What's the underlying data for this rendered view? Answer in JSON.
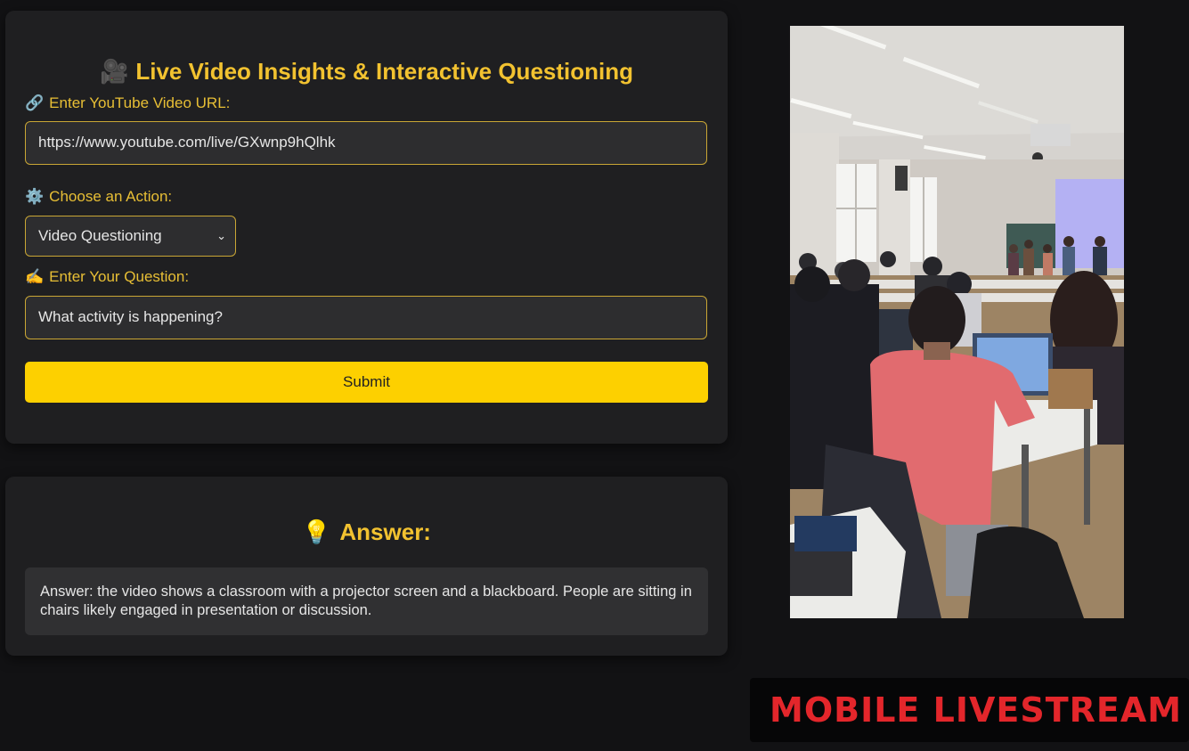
{
  "form": {
    "title_emoji": "🎥",
    "title": "Live Video Insights & Interactive Questioning",
    "url_label_emoji": "🔗",
    "url_label": "Enter YouTube Video URL:",
    "url_value": "https://www.youtube.com/live/GXwnp9hQlhk",
    "action_label_emoji": "⚙️",
    "action_label": "Choose an Action:",
    "action_selected": "Video Questioning",
    "question_label_emoji": "✍️",
    "question_label": "Enter Your Question:",
    "question_value": "What activity is happening?",
    "submit_label": "Submit"
  },
  "answer": {
    "title_emoji": "💡",
    "title": "Answer:",
    "text": "Answer: the video shows a classroom with a projector screen and a blackboard. People are sitting in chairs likely engaged in presentation or discussion."
  },
  "overlay": {
    "caption": "MOBILE LIVESTREAM"
  },
  "colors": {
    "accent": "#f2c230",
    "submit": "#fdd000",
    "caption": "#e3262b",
    "background": "#121214"
  }
}
